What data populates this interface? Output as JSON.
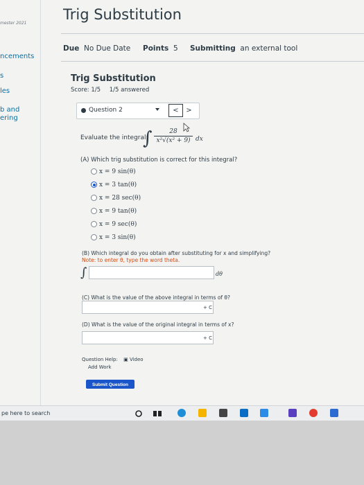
{
  "sidebar": {
    "semester": "mester 2021",
    "items": [
      "ncements",
      "s",
      "les",
      "b and",
      "ering"
    ]
  },
  "page": {
    "title": "Trig Substitution",
    "due_label": "Due",
    "due_value": "No Due Date",
    "points_label": "Points",
    "points_value": "5",
    "submitting_label": "Submitting",
    "submitting_value": "an external tool"
  },
  "quiz": {
    "title": "Trig Substitution",
    "score": "Score: 1/5",
    "answered": "1/5 answered",
    "question_select": "Question 2",
    "prev": "<",
    "next": ">"
  },
  "question": {
    "evaluate_label": "Evaluate the integral:",
    "integrand_numerator": "28",
    "integrand_denominator": "x²√(x² + 9)",
    "dx": "dx",
    "partA": "(A) Which trig substitution is correct for this integral?",
    "options": [
      {
        "text": "x = 9 sin(θ)",
        "checked": false
      },
      {
        "text": "x = 3 tan(θ)",
        "checked": true
      },
      {
        "text": "x = 28 sec(θ)",
        "checked": false
      },
      {
        "text": "x = 9 tan(θ)",
        "checked": false
      },
      {
        "text": "x = 9 sec(θ)",
        "checked": false
      },
      {
        "text": "x = 3 sin(θ)",
        "checked": false
      }
    ],
    "partB": "(B) Which integral do you obtain after substituting for x and simplifying?",
    "note": "Note: to enter θ, type the word theta.",
    "dtheta": "dθ",
    "partC": "(C) What is the value of the above integral in terms of θ?",
    "partD": "(D) What is the value of the original integral in terms of x?",
    "plus_c": "+ C",
    "help_label": "Question Help:",
    "video_label": "Video",
    "add_work": "Add Work",
    "submit": "Submit Question"
  },
  "taskbar": {
    "search_placeholder": "pe here to search"
  }
}
